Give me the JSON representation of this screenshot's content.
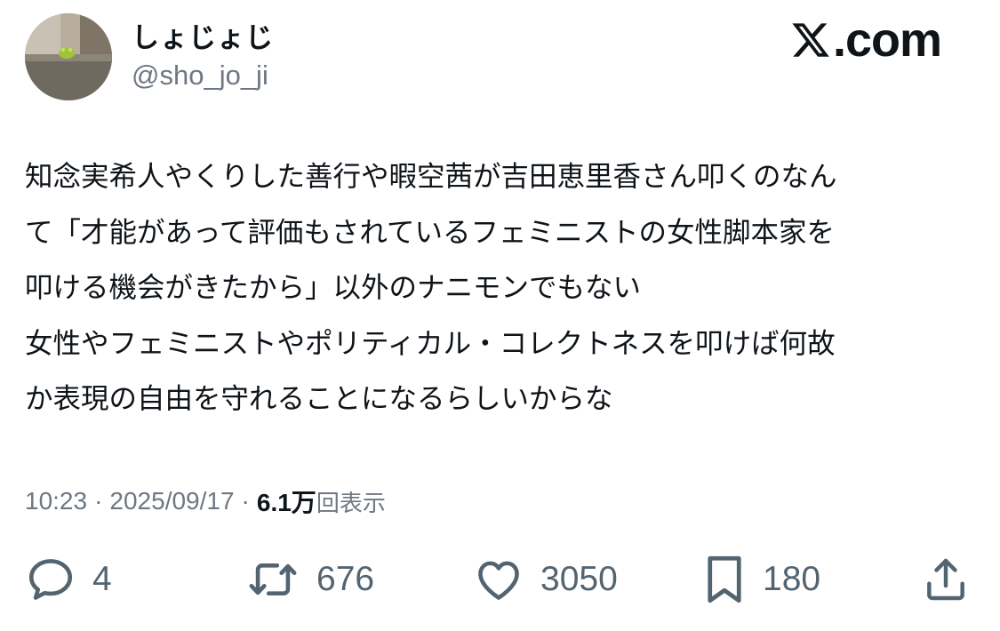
{
  "author": {
    "display_name": "しょじょじ",
    "handle": "@sho_jo_ji"
  },
  "brand": {
    "text": ".com",
    "logo_icon": "x-logo-icon"
  },
  "tweet": {
    "lines": [
      "知念実希人やくりした善行や暇空茜が吉田恵里香さん叩くのなん",
      "て「才能があって評価もされているフェミニストの女性脚本家を",
      "叩ける機会がきたから」以外のナニモンでもない",
      "女性やフェミニストやポリティカル・コレクトネスを叩けば何故",
      "か表現の自由を守れることになるらしいからな"
    ]
  },
  "meta": {
    "time": "10:23",
    "separator": "·",
    "date": "2025/09/17",
    "views_count": "6.1万",
    "views_label": "回表示"
  },
  "actions": {
    "reply": {
      "count": "4",
      "icon": "reply-icon"
    },
    "retweet": {
      "count": "676",
      "icon": "retweet-icon"
    },
    "like": {
      "count": "3050",
      "icon": "heart-icon"
    },
    "bookmark": {
      "count": "180",
      "icon": "bookmark-icon"
    },
    "share": {
      "icon": "share-icon"
    }
  },
  "colors": {
    "text": "#0f1419",
    "secondary": "#6e7781",
    "action": "#536471"
  }
}
